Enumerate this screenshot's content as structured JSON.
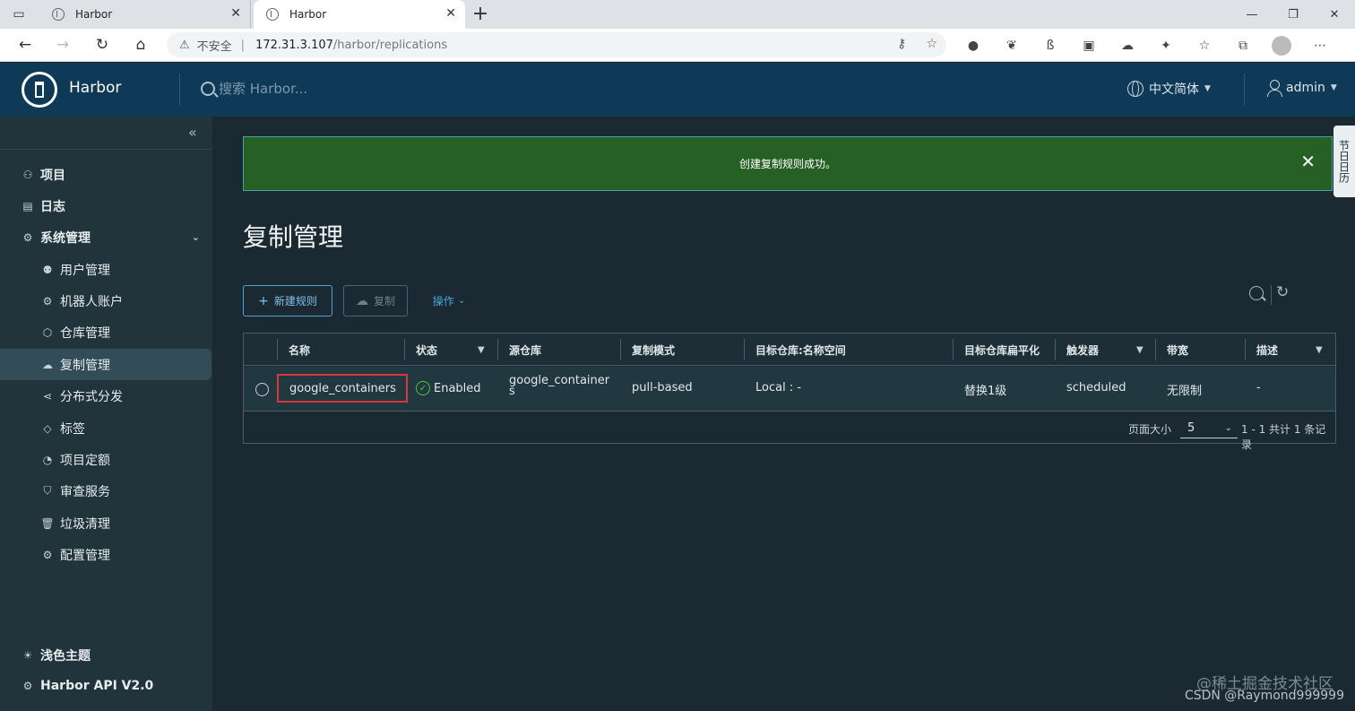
{
  "browser": {
    "tabs": [
      {
        "title": "Harbor",
        "active": false
      },
      {
        "title": "Harbor",
        "active": true
      }
    ],
    "url_warning": "不安全",
    "url_host": "172.31.3.107",
    "url_path": "/harbor/replications"
  },
  "header": {
    "app_name": "Harbor",
    "search_placeholder": "搜索 Harbor...",
    "language": "中文简体",
    "user": "admin",
    "bg_color": "#0e3a58"
  },
  "sidebar": {
    "items": [
      {
        "label": "项目",
        "icon": "projects-icon"
      },
      {
        "label": "日志",
        "icon": "logs-icon"
      },
      {
        "label": "系统管理",
        "icon": "admin-icon"
      }
    ],
    "sub_items": [
      {
        "label": "用户管理",
        "icon": "users-icon"
      },
      {
        "label": "机器人账户",
        "icon": "robot-icon"
      },
      {
        "label": "仓库管理",
        "icon": "registry-icon"
      },
      {
        "label": "复制管理",
        "icon": "replication-icon"
      },
      {
        "label": "分布式分发",
        "icon": "distribution-icon"
      },
      {
        "label": "标签",
        "icon": "tag-icon"
      },
      {
        "label": "项目定额",
        "icon": "quota-icon"
      },
      {
        "label": "审查服务",
        "icon": "shield-icon"
      },
      {
        "label": "垃圾清理",
        "icon": "trash-icon"
      },
      {
        "label": "配置管理",
        "icon": "gear-icon"
      }
    ],
    "footer": {
      "theme": "浅色主题",
      "api": "Harbor API V2.0"
    }
  },
  "alert": {
    "message": "创建复制规则成功。",
    "color": "#266024"
  },
  "side_tab": "节日日历",
  "page": {
    "title": "复制管理",
    "buttons": {
      "new_rule": "新建规则",
      "copy": "复制",
      "action": "操作"
    }
  },
  "table": {
    "columns": [
      "名称",
      "状态",
      "源仓库",
      "复制模式",
      "目标仓库:名称空间",
      "目标仓库扁平化",
      "触发器",
      "带宽",
      "描述"
    ],
    "rows": [
      {
        "name": "google_containers",
        "status": "Enabled",
        "source_repo": "google_containers",
        "mode": "pull-based",
        "target": "Local : -",
        "flatten": "替换1级",
        "trigger": "scheduled",
        "bandwidth": "无限制",
        "description": "-"
      }
    ],
    "page_size_label": "页面大小",
    "page_size": "5",
    "page_info": "1 - 1 共计 1 条记录"
  },
  "watermark": {
    "line1": "@稀土掘金技术社区",
    "line2": "CSDN @Raymond999999"
  }
}
